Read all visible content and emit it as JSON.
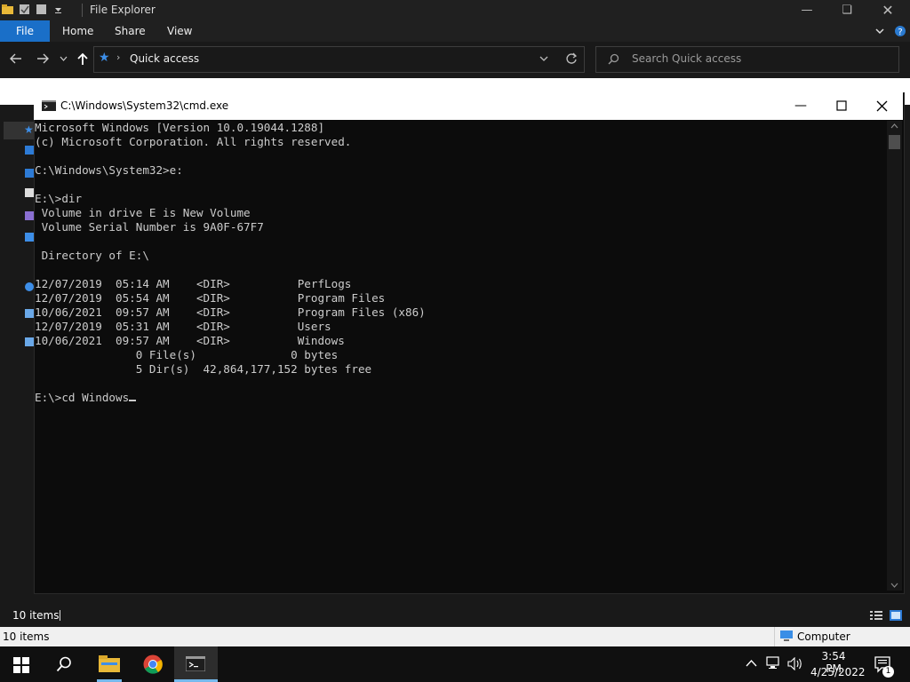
{
  "explorer": {
    "title": "File Explorer",
    "tabs": [
      "File",
      "Home",
      "Share",
      "View"
    ],
    "address": "Quick access",
    "search_placeholder": "Search Quick access",
    "status_items": "10 items",
    "status_items_bottom": "10 items",
    "status_location": "Computer"
  },
  "cmd": {
    "title": "C:\\Windows\\System32\\cmd.exe",
    "lines": [
      "Microsoft Windows [Version 10.0.19044.1288]",
      "(c) Microsoft Corporation. All rights reserved.",
      "",
      "C:\\Windows\\System32>e:",
      "",
      "E:\\>dir",
      " Volume in drive E is New Volume",
      " Volume Serial Number is 9A0F-67F7",
      "",
      " Directory of E:\\",
      "",
      "12/07/2019  05:14 AM    <DIR>          PerfLogs",
      "12/07/2019  05:54 AM    <DIR>          Program Files",
      "10/06/2021  09:57 AM    <DIR>          Program Files (x86)",
      "12/07/2019  05:31 AM    <DIR>          Users",
      "10/06/2021  09:57 AM    <DIR>          Windows",
      "               0 File(s)              0 bytes",
      "               5 Dir(s)  42,864,177,152 bytes free",
      ""
    ],
    "prompt": "E:\\>cd Windows"
  },
  "taskbar": {
    "time": "3:54 PM",
    "date": "4/25/2022",
    "notification_count": "1"
  },
  "colors": {
    "accent": "#1a6fc8",
    "console_bg": "#0c0c0c",
    "console_text": "#cccccc"
  }
}
